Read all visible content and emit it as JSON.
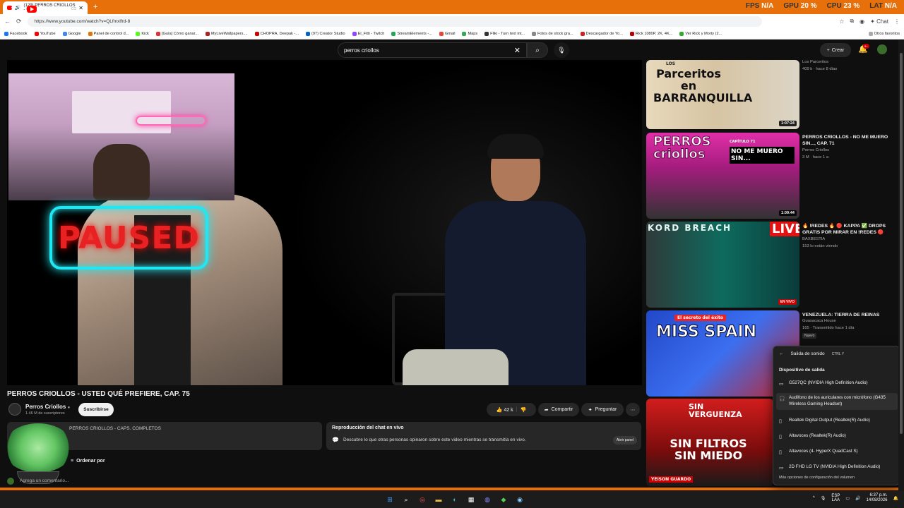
{
  "browser": {
    "tab_title": "(129) PERROS CRIOLLOS - US",
    "tab_close": "✕",
    "new_tab": "+",
    "url": "https://www.youtube.com/watch?v=QLfmxlfrd-8",
    "chat_label": "Chat",
    "perf": [
      {
        "label": "FPS",
        "value": "N/A"
      },
      {
        "label": "GPU",
        "value": "20 %"
      },
      {
        "label": "CPU",
        "value": "23 %"
      },
      {
        "label": "LAT",
        "value": "N/A"
      }
    ],
    "bookmarks": [
      "Facebook",
      "YouTube",
      "Google",
      "Panel de control d...",
      "Kick",
      "[Guía] Cómo ganar...",
      "MyLiveWallpapers....",
      "CHOPRA, Deepak -...",
      "(97) Creator Studio",
      "El_Fitti - Twitch",
      "StreamElements -...",
      "Gmail",
      "Maps",
      "Fliki - Turn text int...",
      "Fotos de stock gra...",
      "Descargador de Yo...",
      "Rick 1080P, 2K, 4K...",
      "Ver Rick y Morty (2...",
      "Otros favoritos"
    ]
  },
  "youtube": {
    "logo": "Premium",
    "logo_sup": "CO",
    "search_value": "perros criollos",
    "create_label": "Crear",
    "bell_badge": "9+"
  },
  "player": {
    "overlay_text": "PAUSED"
  },
  "video": {
    "title": "PERROS CRIOLLOS - USTED QUÉ PREFIERE, CAP. 75",
    "channel": "Perros Criollos",
    "subs": "1.46 M de suscriptores",
    "subscribe": "Suscribirse",
    "likes": "42 k",
    "share": "Compartir",
    "ask": "Preguntar",
    "playlist": "PERROS CRIOLLOS - CAPS. COMPLETOS",
    "chat_title": "Reproducción del chat en vivo",
    "chat_desc": "Descubre lo que otras personas opinaron sobre este video mientras se transmitía en vivo.",
    "chat_btn": "Abrir panel",
    "sort": "Ordenar por",
    "comment_placeholder": "Agrega un comentario..."
  },
  "recommendations": [
    {
      "thumb_text": "Parceritos en BARRANQUILLA",
      "thumb_small": "LOS",
      "duration": "1:07:24",
      "channel": "Los Parceritos",
      "meta": "409 k · hace 8 días"
    },
    {
      "thumb_text": "PERROS criollos",
      "thumb_extra": "NO ME MUERO SIN...",
      "thumb_cap": "CAPÍTULO 71",
      "duration": "1:09:44",
      "title": "PERROS CRIOLLOS - NO ME MUERO SIN..., CAP. 71",
      "channel": "Perros Criollos",
      "meta": "3 M · hace 1 a"
    },
    {
      "thumb_text": "KORD BREACH",
      "thumb_live": "LIVE",
      "badge": "EN VIVO",
      "title": "🔥 !REDES 🔥 🔴 KAPPA ✅ DROPS GRATIS POR MIRAR EN !REDES 🔴",
      "channel": "BAXBESTIA",
      "meta": "153 lo están viendo"
    },
    {
      "thumb_text": "MISS SPAIN",
      "thumb_small": "El secreto del éxito",
      "title": "VENEZUELA: TIERRA DE REINAS",
      "channel": "Guasacaca House",
      "meta": "165 · Transmitido hace 1 día",
      "new_badge": "Nuevo"
    },
    {
      "thumb_text": "SIN FILTROS SIN MIEDO",
      "thumb_small": "SIN VERGUENZA",
      "thumb_tag": "YEISON GUARDO"
    }
  ],
  "sound_panel": {
    "title": "Salida de sonido",
    "shortcut": "CTRL  Y",
    "subtitle": "Dispositivo de salida",
    "devices": [
      "G527QC (NVIDIA High Definition Audio)",
      "Audífono de los auriculares con micrófono (G435 Wireless Gaming Headset)",
      "Realtek Digital Output (Realtek(R) Audio)",
      "Altavoces (Realtek(R) Audio)",
      "Altavoces (4- HyperX QuadCast S)",
      "2D FHD LG TV (NVIDIA High Definition Audio)"
    ],
    "footer": "Más opciones de configuración del volumen"
  },
  "taskbar": {
    "lang1": "ESP",
    "lang2": "LAA",
    "time": "6:37 p.m.",
    "date": "14/08/2026"
  },
  "colors": {
    "accent_orange": "#e8700a",
    "yt_red": "#ff0000",
    "neon_cyan": "#21e7f2",
    "paused_red": "#e82222"
  }
}
